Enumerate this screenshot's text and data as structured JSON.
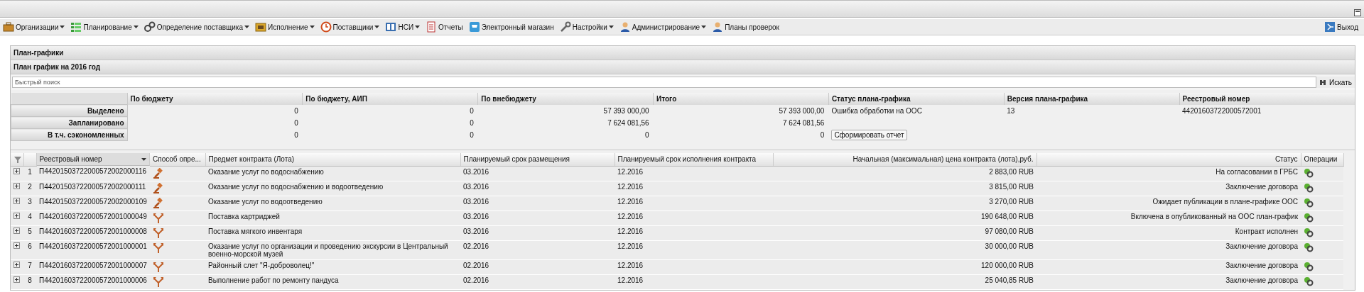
{
  "menu": [
    {
      "label": "Организации",
      "dropdown": true
    },
    {
      "label": "Планирование",
      "dropdown": true
    },
    {
      "label": "Определение поставщика",
      "dropdown": true
    },
    {
      "label": "Исполнение",
      "dropdown": true
    },
    {
      "label": "Поставщики",
      "dropdown": true
    },
    {
      "label": "НСИ",
      "dropdown": true
    },
    {
      "label": "Отчеты",
      "dropdown": false
    },
    {
      "label": "Электронный магазин",
      "dropdown": false
    },
    {
      "label": "Настройки",
      "dropdown": true
    },
    {
      "label": "Администрирование",
      "dropdown": true
    },
    {
      "label": "Планы проверок",
      "dropdown": false
    }
  ],
  "logout": "Выход",
  "panel_title": "План-графики",
  "plan_title": "План график на 2016 год",
  "search": {
    "placeholder": "Быстрый поиск",
    "button": "Искать"
  },
  "summary": {
    "columns": [
      "По бюджету",
      "По бюджету, АИП",
      "По внебюджету",
      "Итого",
      "Статус плана-графика",
      "Версия плана-графика",
      "Реестровый номер"
    ],
    "rows": [
      {
        "label": "Выделено",
        "values": [
          "0",
          "0",
          "57 393 000,00",
          "57 393 000,00"
        ],
        "status": "Ошибка обработки на ООС",
        "version": "13",
        "registry": "44201603722000572001"
      },
      {
        "label": "Запланировано",
        "values": [
          "0",
          "0",
          "7 624 081,56",
          "7 624 081,56"
        ]
      },
      {
        "label": "В т.ч. сэкономленных",
        "values": [
          "0",
          "0",
          "0",
          "0"
        ],
        "button": "Сформировать отчет"
      }
    ]
  },
  "grid": {
    "columns": [
      "Реестровый номер",
      "Способ опре...",
      "Предмет контракта (Лота)",
      "Планируемый срок размещения",
      "Планируемый срок исполнения контракта",
      "Начальная (максимальная) цена контракта (лота),руб.",
      "Статус",
      "Операции"
    ],
    "rows": [
      {
        "num": "1",
        "registry": "П44201503722000572002000116",
        "kind": "gavel",
        "subject": "Оказание услуг по водоснабжению",
        "placement": "03.2016",
        "execution": "12.2016",
        "price": "2 883,00 RUB",
        "status": "На согласовании в ГРБС"
      },
      {
        "num": "2",
        "registry": "П44201503722000572002000111",
        "kind": "gavel",
        "subject": "Оказание услуг по водоснабжению и водоотведению",
        "placement": "03.2016",
        "execution": "12.2016",
        "price": "3 815,00 RUB",
        "status": "Заключение договора"
      },
      {
        "num": "3",
        "registry": "П44201503722000572002000109",
        "kind": "gavel",
        "subject": "Оказание услуг по водоотведению",
        "placement": "03.2016",
        "execution": "12.2016",
        "price": "3 270,00 RUB",
        "status": "Ожидает публикации в плане-графике ООС"
      },
      {
        "num": "4",
        "registry": "П44201603722000572001000049",
        "kind": "branch",
        "subject": "Поставка картриджей",
        "placement": "03.2016",
        "execution": "12.2016",
        "price": "190 648,00 RUB",
        "status": "Включена в опубликованный на ООС план-график"
      },
      {
        "num": "5",
        "registry": "П44201603722000572001000008",
        "kind": "branch",
        "subject": "Поставка мягкого инвентаря",
        "placement": "03.2016",
        "execution": "12.2016",
        "price": "97 080,00 RUB",
        "status": "Контракт исполнен"
      },
      {
        "num": "6",
        "registry": "П44201603722000572001000001",
        "kind": "branch",
        "subject": "Оказание услуг по организации и проведению экскурсии в Центральный военно-морской музей",
        "placement": "02.2016",
        "execution": "12.2016",
        "price": "30 000,00 RUB",
        "status": "Заключение договора"
      },
      {
        "num": "7",
        "registry": "П44201603722000572001000007",
        "kind": "branch",
        "subject": "Районный слет \"Я-доброволец!\"",
        "placement": "02.2016",
        "execution": "12.2016",
        "price": "120 000,00 RUB",
        "status": "Заключение договора"
      },
      {
        "num": "8",
        "registry": "П44201603722000572001000006",
        "kind": "branch",
        "subject": "Выполнение работ по ремонту пандуса",
        "placement": "02.2016",
        "execution": "12.2016",
        "price": "25 040,85 RUB",
        "status": "Заключение договора"
      }
    ]
  }
}
